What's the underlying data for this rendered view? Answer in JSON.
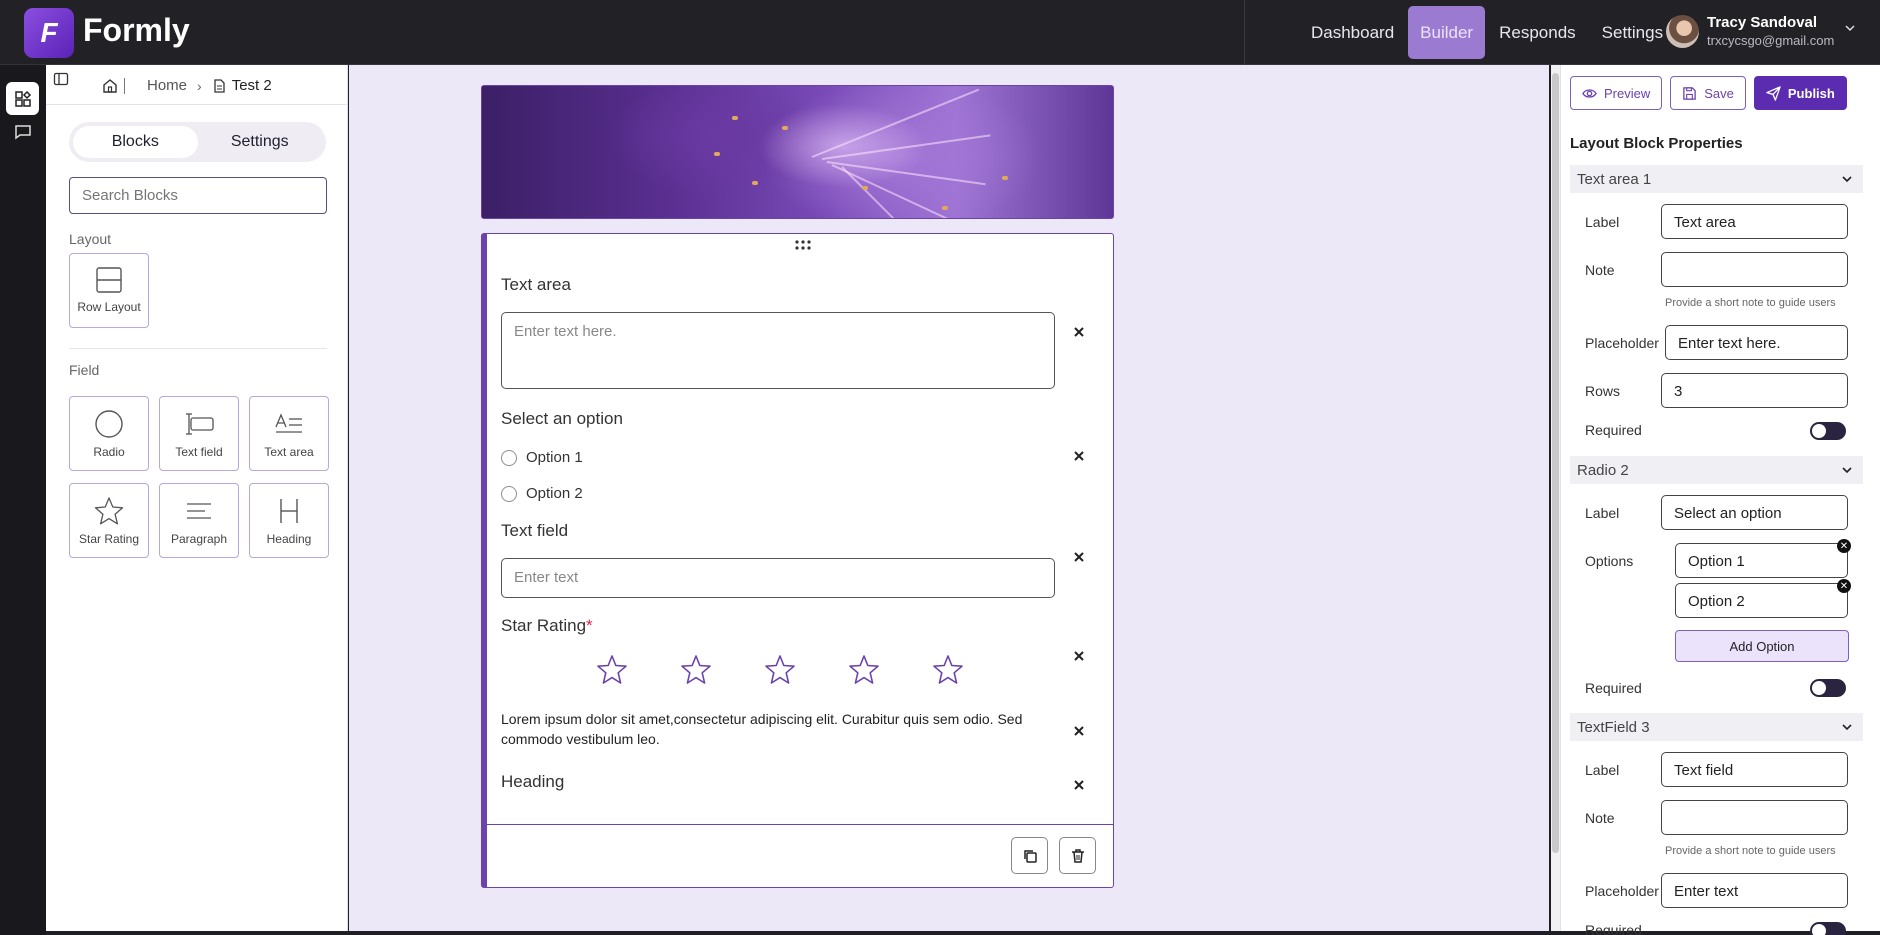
{
  "app": {
    "logo_letter": "F",
    "name": "Formly"
  },
  "topnav": [
    {
      "label": "Dashboard",
      "active": false
    },
    {
      "label": "Builder",
      "active": true
    },
    {
      "label": "Responds",
      "active": false
    },
    {
      "label": "Settings",
      "active": false
    }
  ],
  "user": {
    "name": "Tracy Sandoval",
    "email": "trxcycsgo@gmail.com"
  },
  "breadcrumb": {
    "home": "Home",
    "current": "Test 2"
  },
  "sidebar": {
    "tabs": [
      "Blocks",
      "Settings"
    ],
    "active_tab": "Blocks",
    "search_placeholder": "Search Blocks",
    "layout_title": "Layout",
    "layout_blocks": [
      {
        "label": "Row Layout",
        "icon": "row-layout-icon"
      }
    ],
    "field_title": "Field",
    "field_blocks": [
      {
        "label": "Radio",
        "icon": "radio-icon"
      },
      {
        "label": "Text field",
        "icon": "text-field-icon"
      },
      {
        "label": "Text area",
        "icon": "text-area-icon"
      },
      {
        "label": "Star Rating",
        "icon": "star-icon"
      },
      {
        "label": "Paragraph",
        "icon": "paragraph-icon"
      },
      {
        "label": "Heading",
        "icon": "heading-icon"
      }
    ]
  },
  "form": {
    "text_area": {
      "label": "Text area",
      "placeholder": "Enter text here."
    },
    "radio": {
      "label": "Select an option",
      "options": [
        "Option 1",
        "Option 2"
      ]
    },
    "text_field": {
      "label": "Text field",
      "placeholder": "Enter text"
    },
    "star_rating": {
      "label": "Star Rating",
      "required_mark": "*",
      "stars": 5
    },
    "paragraph": "Lorem ipsum dolor sit amet,consectetur adipiscing elit. Curabitur quis sem odio. Sed commodo vestibulum leo.",
    "heading": "Heading"
  },
  "props": {
    "buttons": {
      "preview": "Preview",
      "save": "Save",
      "publish": "Publish"
    },
    "title": "Layout Block Properties",
    "text_area_block": {
      "header": "Text area 1",
      "label_caption": "Label",
      "label_value": "Text area",
      "note_caption": "Note",
      "note_value": "",
      "note_hint": "Provide a short note to guide users",
      "placeholder_caption": "Placeholder",
      "placeholder_value": "Enter text here.",
      "rows_caption": "Rows",
      "rows_value": "3",
      "required_caption": "Required"
    },
    "radio_block": {
      "header": "Radio 2",
      "label_caption": "Label",
      "label_value": "Select an option",
      "options_caption": "Options",
      "options": [
        "Option 1",
        "Option 2"
      ],
      "add_option": "Add Option",
      "required_caption": "Required"
    },
    "text_field_block": {
      "header": "TextField 3",
      "label_caption": "Label",
      "label_value": "Text field",
      "note_caption": "Note",
      "note_value": "",
      "note_hint": "Provide a short note to guide users",
      "placeholder_caption": "Placeholder",
      "placeholder_value": "Enter text",
      "required_caption": "Required"
    }
  },
  "colors": {
    "accent": "#6b43ad",
    "primary": "#5b2bb0",
    "canvas": "#ede8f7",
    "required": "#e0224a"
  }
}
